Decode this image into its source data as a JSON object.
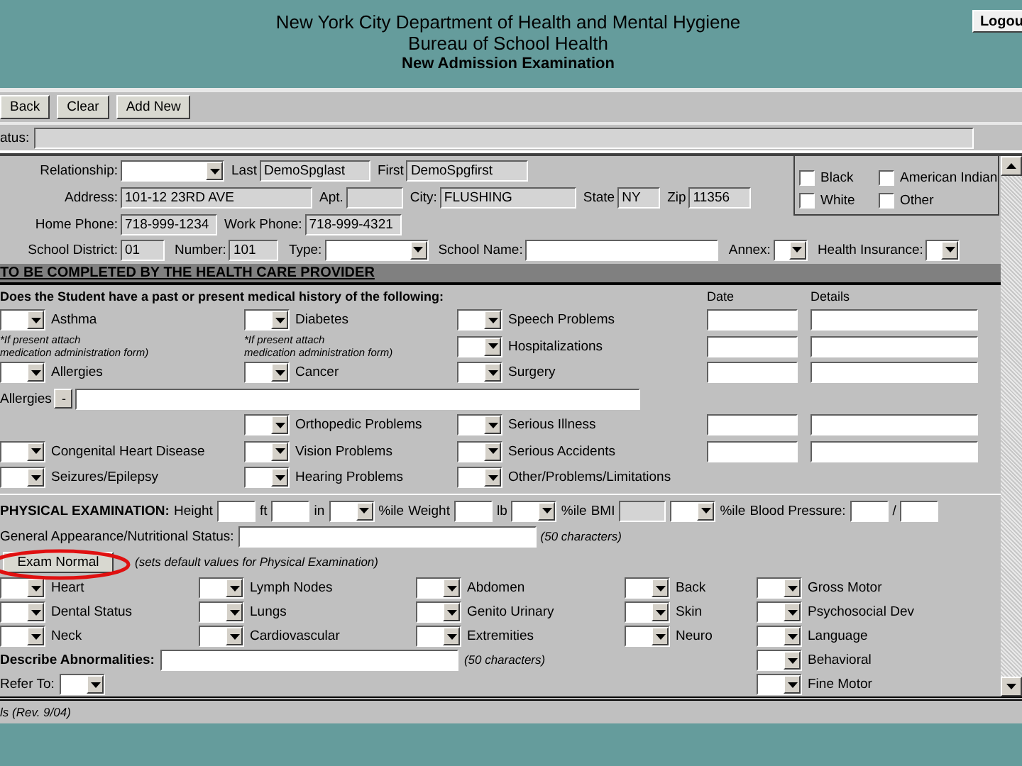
{
  "header": {
    "title": "New York City Department of Health and Mental Hygiene",
    "subtitle": "Bureau of School Health",
    "form_title": "New Admission Examination",
    "logout": "Logou"
  },
  "toolbar": [
    "Back",
    "Clear",
    "Add New"
  ],
  "status": {
    "label": "atus:"
  },
  "student": {
    "relationship": {
      "label": "Relationship:"
    },
    "last": {
      "label": "Last",
      "value": "DemoSpglast"
    },
    "first": {
      "label": "First",
      "value": "DemoSpgfirst"
    },
    "address": {
      "label": "Address:",
      "value": "101-12 23RD AVE"
    },
    "apt": {
      "label": "Apt."
    },
    "city": {
      "label": "City:",
      "value": "FLUSHING"
    },
    "state": {
      "label": "State",
      "value": "NY"
    },
    "zip": {
      "label": "Zip",
      "value": "11356"
    },
    "home_phone": {
      "label": "Home Phone:",
      "value": "718-999-1234"
    },
    "work_phone": {
      "label": "Work Phone:",
      "value": "718-999-4321"
    },
    "school_district": {
      "label": "School District:",
      "value": "01"
    },
    "number": {
      "label": "Number:",
      "value": "101"
    },
    "type": {
      "label": "Type:"
    },
    "school_name": {
      "label": "School Name:"
    },
    "annex": {
      "label": "Annex:"
    },
    "health_insurance": {
      "label": "Health Insurance:"
    }
  },
  "race": [
    {
      "label": "Black",
      "checked": false
    },
    {
      "label": "American Indian",
      "checked": false
    },
    {
      "label": "White",
      "checked": false
    },
    {
      "label": "Other",
      "checked": false
    }
  ],
  "section_title": "TO BE COMPLETED BY THE HEALTH CARE PROVIDER",
  "history": {
    "question": "Does the Student have a past or present medical history of the following:",
    "date_heading": "Date",
    "details_heading": "Details",
    "rows": [
      {
        "kind": "conditions",
        "dated": true,
        "cells": [
          {
            "kind": "select",
            "label": "Asthma"
          },
          {
            "kind": "select",
            "label": "Diabetes"
          },
          {
            "kind": "select",
            "label": "Speech Problems"
          }
        ]
      },
      {
        "kind": "conditions",
        "dated": true,
        "cells": [
          {
            "kind": "note",
            "lines": [
              "*If present attach",
              "medication administration form)"
            ]
          },
          {
            "kind": "note",
            "lines": [
              "*If present attach",
              "medication administration form)"
            ]
          },
          {
            "kind": "select",
            "label": "Hospitalizations"
          }
        ]
      },
      {
        "kind": "conditions",
        "dated": true,
        "cells": [
          {
            "kind": "select",
            "label": "Allergies"
          },
          {
            "kind": "select",
            "label": "Cancer"
          },
          {
            "kind": "select",
            "label": "Surgery"
          }
        ]
      },
      {
        "kind": "allergies",
        "label": "Allergies",
        "button": "-"
      },
      {
        "kind": "conditions",
        "dated": true,
        "cells": [
          {
            "kind": "blank"
          },
          {
            "kind": "select",
            "label": "Orthopedic Problems"
          },
          {
            "kind": "select",
            "label": "Serious Illness"
          }
        ]
      },
      {
        "kind": "conditions",
        "dated": true,
        "cells": [
          {
            "kind": "select",
            "label": "Congenital Heart Disease"
          },
          {
            "kind": "select",
            "label": "Vision Problems"
          },
          {
            "kind": "select",
            "label": "Serious Accidents"
          }
        ]
      },
      {
        "kind": "conditions",
        "dated": false,
        "cells": [
          {
            "kind": "select",
            "label": "Seizures/Epilepsy"
          },
          {
            "kind": "select",
            "label": "Hearing Problems"
          },
          {
            "kind": "select",
            "label": "Other/Problems/Limitations"
          }
        ]
      }
    ]
  },
  "physical": {
    "heading": "PHYSICAL EXAMINATION:",
    "vitals": [
      {
        "kind": "text",
        "text": "Height"
      },
      {
        "kind": "field"
      },
      {
        "kind": "text",
        "text": "ft"
      },
      {
        "kind": "field"
      },
      {
        "kind": "text",
        "text": "in"
      },
      {
        "kind": "select"
      },
      {
        "kind": "text",
        "text": "%ile"
      },
      {
        "kind": "text",
        "text": "Weight"
      },
      {
        "kind": "field"
      },
      {
        "kind": "text",
        "text": "lb"
      },
      {
        "kind": "select"
      },
      {
        "kind": "text",
        "text": "%ile"
      },
      {
        "kind": "text",
        "text": "BMI"
      },
      {
        "kind": "readonly_field"
      },
      {
        "kind": "select"
      },
      {
        "kind": "text",
        "text": "%ile"
      },
      {
        "kind": "text",
        "text": "Blood Pressure:"
      },
      {
        "kind": "field"
      },
      {
        "kind": "text",
        "text": "/"
      },
      {
        "kind": "field"
      }
    ],
    "general": {
      "label": "General Appearance/Nutritional Status:",
      "hint": "(50 characters)"
    },
    "exam_normal": {
      "button": "Exam Normal",
      "note": "(sets default values for Physical Examination)"
    },
    "exam_columns": [
      [
        "Heart",
        "Dental Status",
        "Neck"
      ],
      [
        "Lymph Nodes",
        "Lungs",
        "Cardiovascular"
      ],
      [
        "Abdomen",
        "Genito Urinary",
        "Extremities"
      ],
      [
        "Back",
        "Skin",
        "Neuro"
      ],
      [
        "Gross Motor",
        "Psychosocial Dev",
        "Language",
        "Behavioral",
        "Fine Motor"
      ]
    ],
    "describe": {
      "label": "Describe Abnormalities:",
      "hint": "(50 characters)"
    },
    "refer": {
      "label": "Refer To:"
    }
  },
  "footer": "ls (Rev. 9/04)"
}
